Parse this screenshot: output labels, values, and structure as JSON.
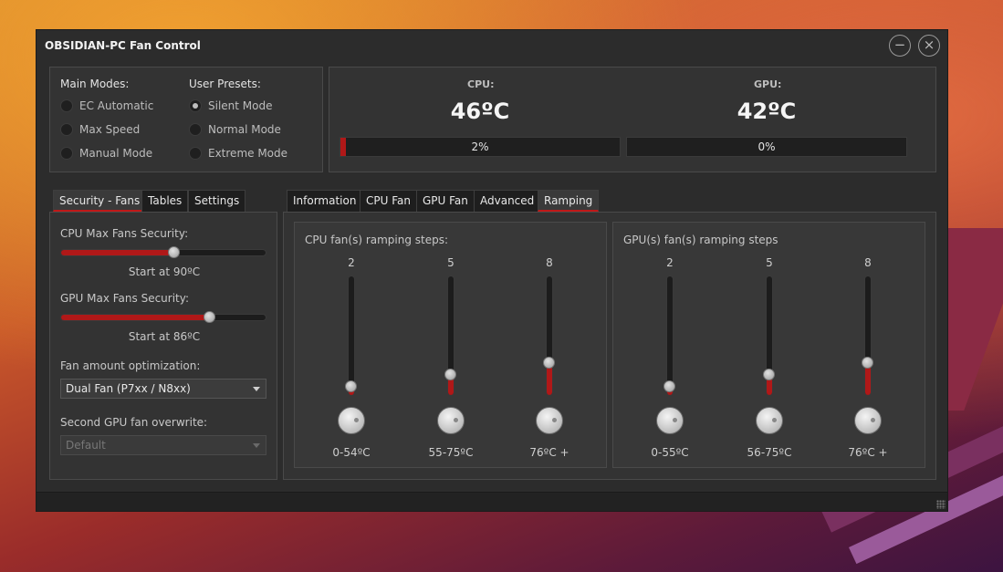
{
  "window": {
    "title": "OBSIDIAN-PC Fan Control",
    "minimize_glyph": "−",
    "close_glyph": "×"
  },
  "modes": {
    "main_title": "Main Modes:",
    "main": [
      {
        "label": "EC Automatic",
        "selected": false
      },
      {
        "label": "Max Speed",
        "selected": false
      },
      {
        "label": "Manual Mode",
        "selected": false
      }
    ],
    "presets_title": "User Presets:",
    "presets": [
      {
        "label": "Silent Mode",
        "selected": true
      },
      {
        "label": "Normal Mode",
        "selected": false
      },
      {
        "label": "Extreme Mode",
        "selected": false
      }
    ]
  },
  "temps": {
    "cpu_label": "CPU:",
    "cpu_value": "46ºC",
    "cpu_fan_percent": "2%",
    "cpu_fan_fraction": 0.02,
    "gpu_label": "GPU:",
    "gpu_value": "42ºC",
    "gpu_fan_percent": "0%",
    "gpu_fan_fraction": 0.0
  },
  "left_tabs": [
    {
      "label": "Security - Fans",
      "active": true
    },
    {
      "label": "Tables",
      "active": false
    },
    {
      "label": "Settings",
      "active": false
    }
  ],
  "security": {
    "cpu_label": "CPU Max Fans Security:",
    "cpu_fraction": 0.55,
    "cpu_start": "Start at 90ºC",
    "gpu_label": "GPU Max Fans Security:",
    "gpu_fraction": 0.72,
    "gpu_start": "Start at 86ºC",
    "fan_amount_label": "Fan amount optimization:",
    "fan_amount_value": "Dual Fan (P7xx / N8xx)",
    "second_gpu_label": "Second GPU fan overwrite:",
    "second_gpu_value": "Default"
  },
  "right_tabs": [
    {
      "label": "Information",
      "active": false
    },
    {
      "label": "CPU Fan",
      "active": false
    },
    {
      "label": "GPU Fan",
      "active": false
    },
    {
      "label": "Advanced",
      "active": false
    },
    {
      "label": "Ramping",
      "active": true
    }
  ],
  "ramping": {
    "cpu_title": "CPU fan(s) ramping steps:",
    "cpu_steps": [
      {
        "value": "2",
        "level": 0.08,
        "range": "0-54ºC"
      },
      {
        "value": "5",
        "level": 0.18,
        "range": "55-75ºC"
      },
      {
        "value": "8",
        "level": 0.28,
        "range": "76ºC +"
      }
    ],
    "gpu_title": "GPU(s) fan(s) ramping steps",
    "gpu_steps": [
      {
        "value": "2",
        "level": 0.08,
        "range": "0-55ºC"
      },
      {
        "value": "5",
        "level": 0.18,
        "range": "56-75ºC"
      },
      {
        "value": "8",
        "level": 0.28,
        "range": "76ºC +"
      }
    ]
  },
  "colors": {
    "accent": "#b01818",
    "window": "#2c2c2c",
    "panel": "#333333"
  }
}
